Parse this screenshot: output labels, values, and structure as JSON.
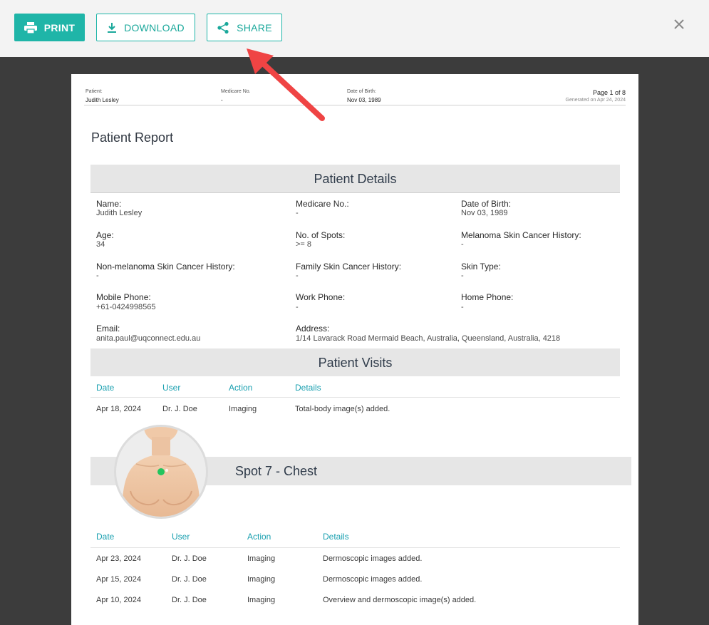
{
  "toolbar": {
    "print_label": "PRINT",
    "download_label": "DOWNLOAD",
    "share_label": "SHARE",
    "accent": "#1fb5a8"
  },
  "page_header": {
    "patient_label": "Patient:",
    "patient_value": "Judith Lesley",
    "medicare_label": "Medicare No.",
    "medicare_value": "-",
    "dob_label": "Date of Birth:",
    "dob_value": "Nov 03, 1989",
    "page_info": "Page 1 of 8",
    "generated": "Generated on Apr 24, 2024"
  },
  "report_title": "Patient Report",
  "patient_details": {
    "heading": "Patient Details",
    "fields": [
      {
        "label": "Name:",
        "value": "Judith Lesley"
      },
      {
        "label": "Medicare No.:",
        "value": "-"
      },
      {
        "label": "Date of Birth:",
        "value": "Nov 03, 1989"
      },
      {
        "label": "Age:",
        "value": "34"
      },
      {
        "label": "No. of Spots:",
        "value": ">= 8"
      },
      {
        "label": "Melanoma Skin Cancer History:",
        "value": "-"
      },
      {
        "label": "Non-melanoma Skin Cancer History:",
        "value": "-"
      },
      {
        "label": "Family Skin Cancer History:",
        "value": "-"
      },
      {
        "label": "Skin Type:",
        "value": "-"
      },
      {
        "label": "Mobile Phone:",
        "value": "+61-0424998565"
      },
      {
        "label": "Work Phone:",
        "value": "-"
      },
      {
        "label": "Home Phone:",
        "value": "-"
      },
      {
        "label": "Email:",
        "value": "anita.paul@uqconnect.edu.au"
      },
      {
        "label": "Address:",
        "value": "1/14 Lavarack Road Mermaid Beach, Australia, Queensland, Australia, 4218"
      }
    ]
  },
  "patient_visits": {
    "heading": "Patient Visits",
    "columns": [
      "Date",
      "User",
      "Action",
      "Details"
    ],
    "rows": [
      [
        "Apr 18, 2024",
        "Dr. J. Doe",
        "Imaging",
        "Total-body image(s) added."
      ]
    ]
  },
  "spot": {
    "heading": "Spot 7 - Chest",
    "columns": [
      "Date",
      "User",
      "Action",
      "Details"
    ],
    "rows": [
      [
        "Apr 23, 2024",
        "Dr. J. Doe",
        "Imaging",
        "Dermoscopic images added."
      ],
      [
        "Apr 15, 2024",
        "Dr. J. Doe",
        "Imaging",
        "Dermoscopic images added."
      ],
      [
        "Apr 10, 2024",
        "Dr. J. Doe",
        "Imaging",
        "Overview and dermoscopic image(s) added."
      ]
    ],
    "marker_color": "#22c55e"
  },
  "colors": {
    "header_text_teal": "#1aa0b0",
    "band_gray": "#e6e6e6",
    "overlay": "#3c3c3c",
    "annotation_arrow": "#ef4444"
  }
}
